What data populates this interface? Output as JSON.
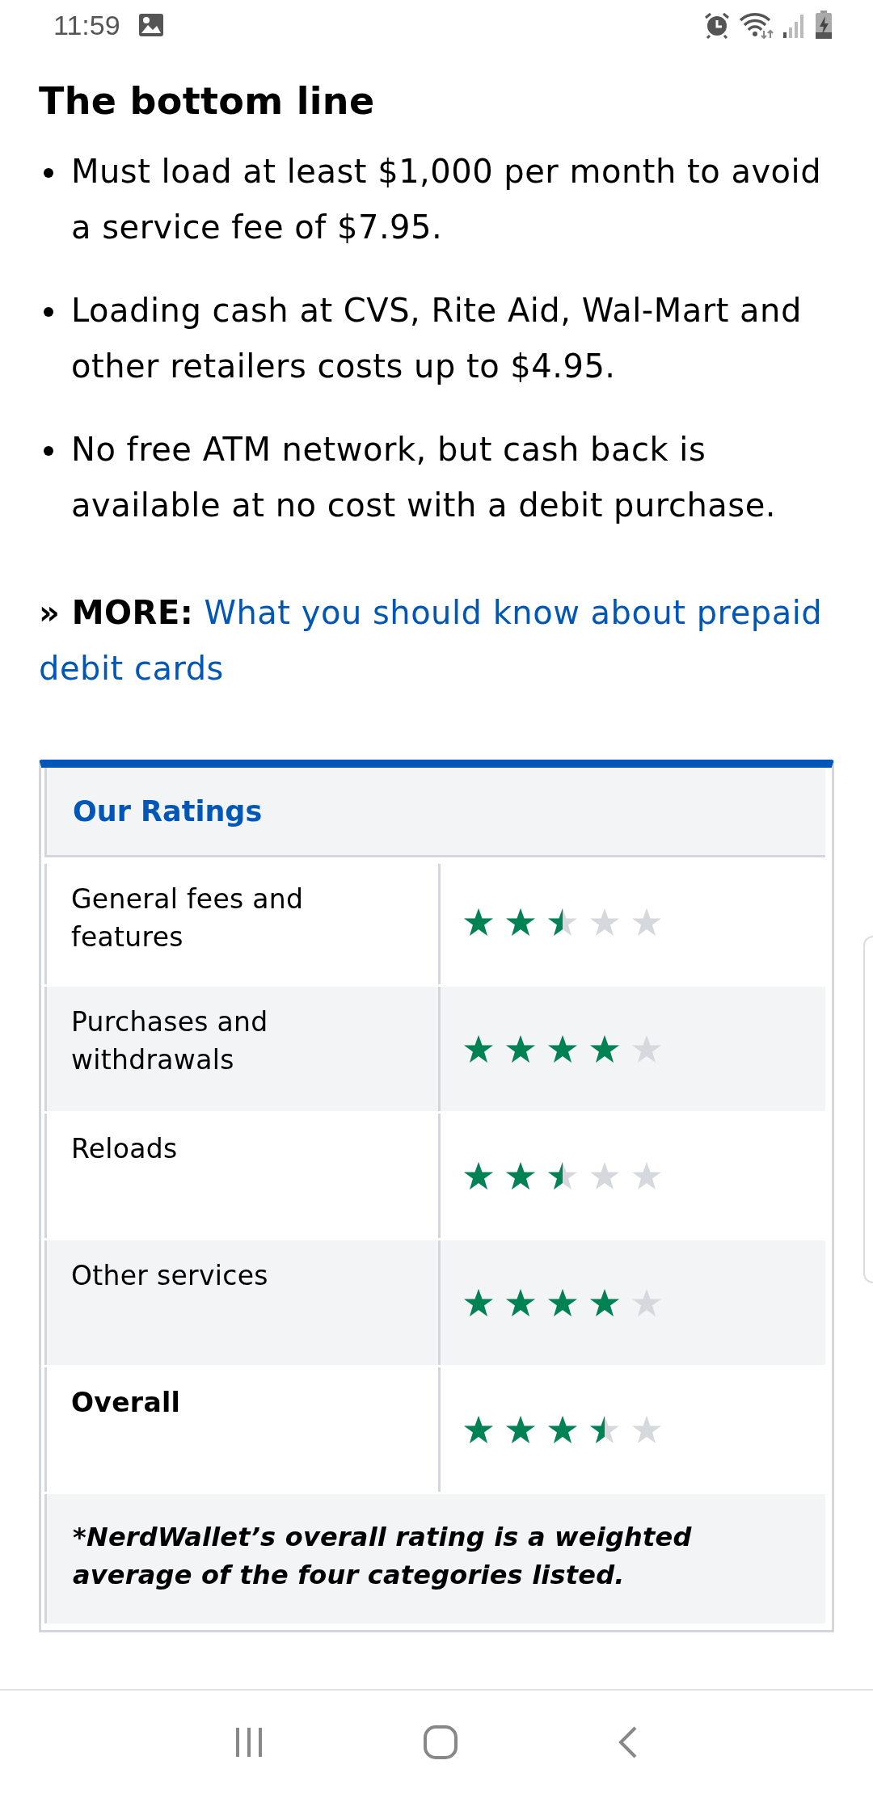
{
  "status_bar": {
    "time": "11:59"
  },
  "article": {
    "heading": "The bottom line",
    "bullets": [
      "Must load at least $1,000 per month to avoid a service fee of $7.95.",
      "Loading cash at CVS, Rite Aid, Wal-Mart and other retailers costs up to $4.95.",
      "No free ATM network, but cash back is available at no cost with a debit purchase."
    ],
    "more": {
      "label": "» MORE:",
      "link": "What you should know about prepaid debit cards"
    }
  },
  "ratings": {
    "title": "Our Ratings",
    "rows": [
      {
        "label": "General fees and features",
        "stars": 2.5,
        "kind": "normal"
      },
      {
        "label": "Purchases and withdrawals",
        "stars": 4,
        "kind": "normal"
      },
      {
        "label": "Reloads",
        "stars": 2.5,
        "kind": "normal"
      },
      {
        "label": "Other services",
        "stars": 4,
        "kind": "normal"
      },
      {
        "label": "Overall",
        "stars": 3.5,
        "kind": "total"
      }
    ],
    "footnote": "*NerdWallet’s overall rating is a weighted average of the four categories listed."
  }
}
